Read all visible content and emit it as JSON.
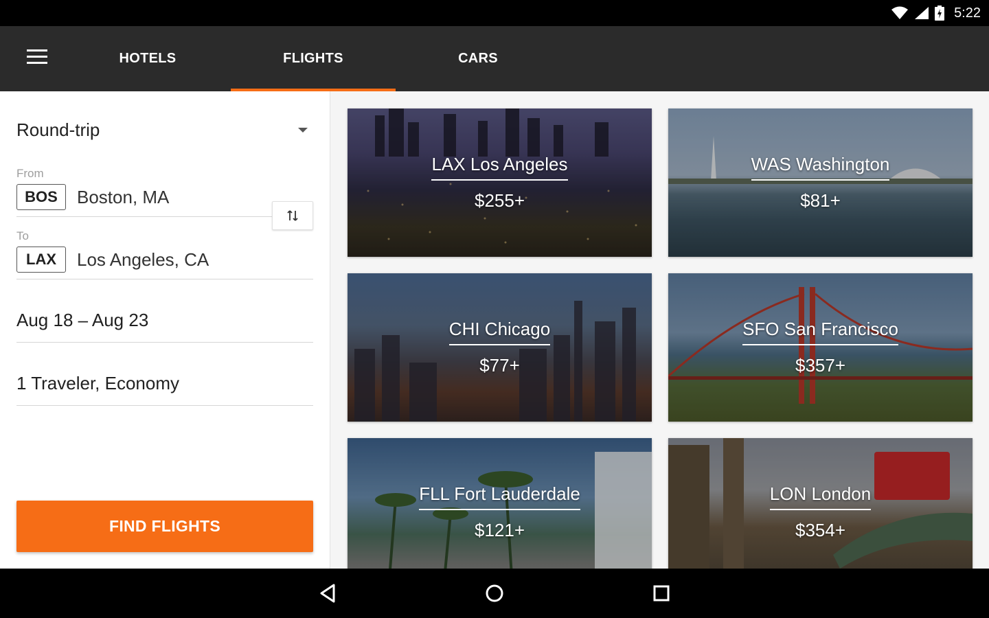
{
  "status_bar": {
    "time": "5:22",
    "icons": [
      "wifi-icon",
      "signal-icon",
      "battery-charging-icon"
    ]
  },
  "app_bar": {
    "menu_icon": "hamburger-menu-icon",
    "tabs": [
      {
        "label": "HOTELS",
        "selected": false
      },
      {
        "label": "FLIGHTS",
        "selected": true
      },
      {
        "label": "CARS",
        "selected": false
      }
    ],
    "accent": "#f66d16"
  },
  "search": {
    "trip_type": "Round-trip",
    "from": {
      "label": "From",
      "code": "BOS",
      "city": "Boston, MA"
    },
    "to": {
      "label": "To",
      "code": "LAX",
      "city": "Los Angeles, CA"
    },
    "swap_icon": "swap-vertical-icon",
    "dates": "Aug 18 – Aug 23",
    "travelers": "1 Traveler, Economy",
    "find_label": "FIND FLIGHTS"
  },
  "destinations": [
    {
      "name": "LAX Los Angeles",
      "price": "$255+"
    },
    {
      "name": "WAS Washington",
      "price": "$81+"
    },
    {
      "name": "CHI Chicago",
      "price": "$77+"
    },
    {
      "name": "SFO San Francisco",
      "price": "$357+"
    },
    {
      "name": "FLL Fort Lauderdale",
      "price": "$121+"
    },
    {
      "name": "LON London",
      "price": "$354+"
    }
  ],
  "nav_bar": {
    "icons": [
      "back-icon",
      "home-icon",
      "recents-icon"
    ]
  }
}
